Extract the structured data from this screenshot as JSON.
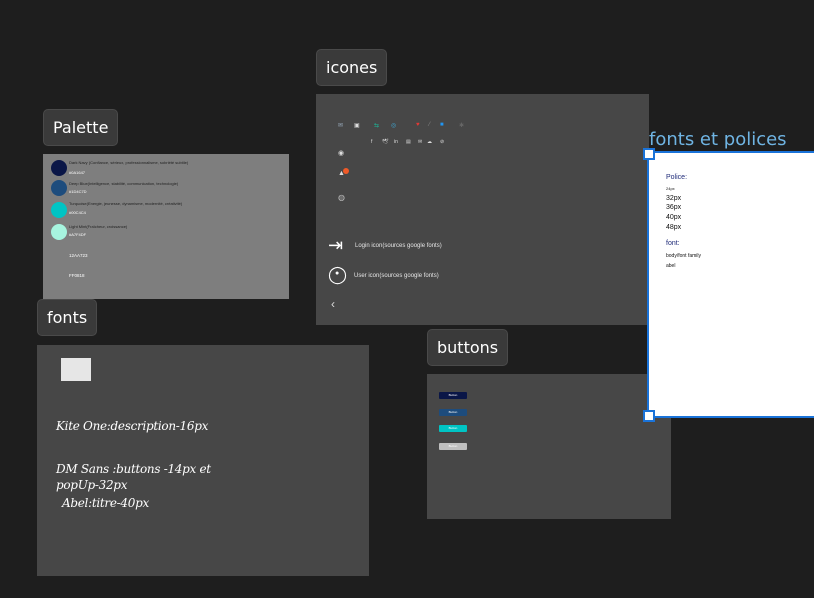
{
  "labels": {
    "palette": "Palette",
    "icones": "icones",
    "fonts": "fonts",
    "buttons": "buttons",
    "fonts_polices": "fonts et polices"
  },
  "palette": {
    "swatches": [
      {
        "name": "Dark Navy (Confiance, sérieux, professionnalisme, sobriété subtile)",
        "hex": "#0A1647",
        "color": "#0A1647"
      },
      {
        "name": "Deep Blue(Intelligence, stabilité, communication, technologie)",
        "hex": "#1D4C7D",
        "color": "#1D4C7D"
      },
      {
        "name": "Turquoise(Energie, jeunesse, dynamisme, modernité, créativité)",
        "hex": "#00C4C4",
        "color": "#00C4C4"
      },
      {
        "name": "Light Mint(Fraîcheur, croissance)",
        "hex": "#A7F4DF",
        "color": "#A7F4DF"
      }
    ],
    "extra": [
      "12AA723",
      "FF0818"
    ]
  },
  "icones": {
    "login_label": "Login icon(sources google fonts)",
    "user_label": "User icon(sources google fonts)"
  },
  "fonts": {
    "line1": "Kite One:description-16px",
    "line2": "DM Sans :buttons -14px et",
    "line3": "popUp-32px",
    "line4": "Abel:titre-40px"
  },
  "buttons": {
    "items": [
      {
        "label": "Button",
        "color": "#0A1647"
      },
      {
        "label": "Button",
        "color": "#1D4C7D"
      },
      {
        "label": "Button",
        "color": "#00C4C4"
      },
      {
        "label": "Button",
        "color": "#BFBFBF"
      }
    ]
  },
  "polices": {
    "police_heading": "Police:",
    "sizes": [
      "24px",
      "32px",
      "36px",
      "40px",
      "48px"
    ],
    "font_heading": "font:",
    "fonts": [
      "body/font family",
      "abel"
    ]
  },
  "colors": {
    "canvas": "#1e1e1e",
    "panel": "#474747",
    "selection": "#1a73d9"
  }
}
